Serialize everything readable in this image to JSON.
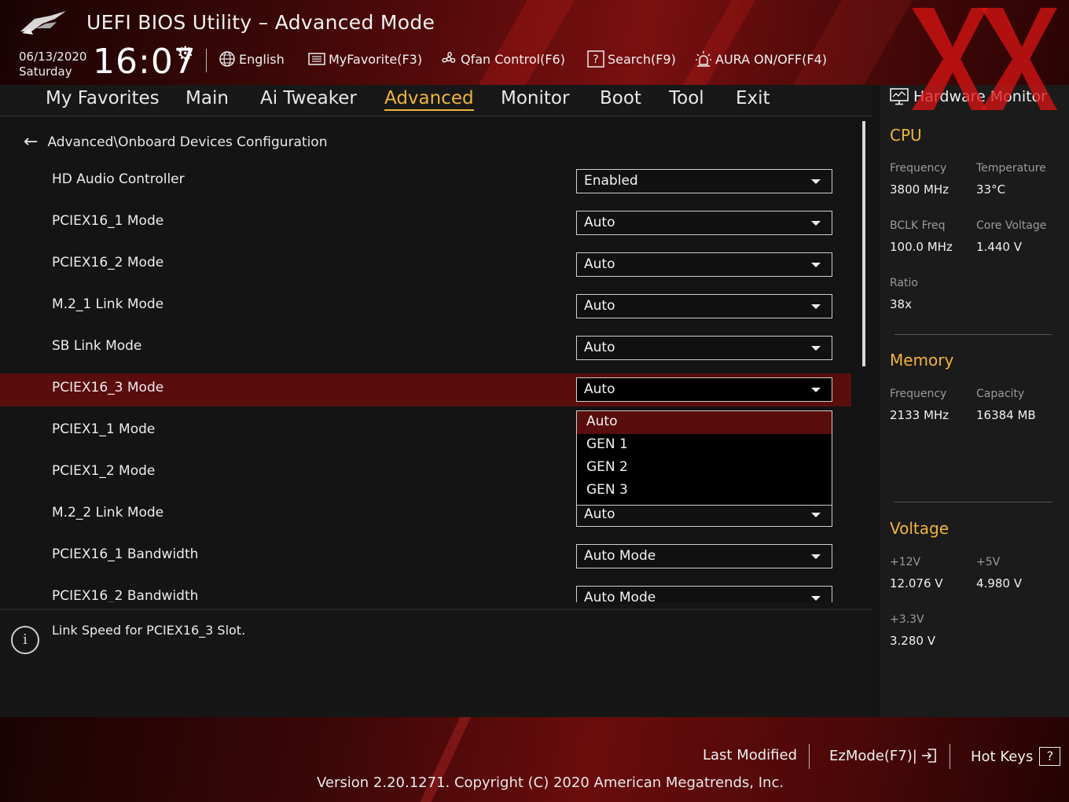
{
  "header": {
    "title": "UEFI BIOS Utility – Advanced Mode",
    "date": "06/13/2020",
    "day": "Saturday",
    "time": "16:07",
    "language": "English",
    "favorite": "MyFavorite(F3)",
    "qfan": "Qfan Control(F6)",
    "search": "Search(F9)",
    "aura": "AURA ON/OFF(F4)"
  },
  "nav": {
    "tabs": [
      "My Favorites",
      "Main",
      "Ai Tweaker",
      "Advanced",
      "Monitor",
      "Boot",
      "Tool",
      "Exit"
    ],
    "active": "Advanced"
  },
  "main": {
    "breadcrumb": "Advanced\\Onboard Devices Configuration",
    "rows": [
      {
        "label": "HD Audio Controller",
        "value": "Enabled"
      },
      {
        "label": "PCIEX16_1 Mode",
        "value": "Auto"
      },
      {
        "label": "PCIEX16_2 Mode",
        "value": "Auto"
      },
      {
        "label": "M.2_1 Link Mode",
        "value": "Auto"
      },
      {
        "label": "SB Link Mode",
        "value": "Auto"
      },
      {
        "label": "PCIEX16_3 Mode",
        "value": "Auto"
      },
      {
        "label": "PCIEX1_1 Mode",
        "value": ""
      },
      {
        "label": "PCIEX1_2 Mode",
        "value": ""
      },
      {
        "label": "M.2_2 Link Mode",
        "value": "Auto"
      },
      {
        "label": "PCIEX16_1 Bandwidth",
        "value": "Auto Mode"
      },
      {
        "label": "PCIEX16_2 Bandwidth",
        "value": "Auto Mode"
      }
    ],
    "dropdown_options": [
      "Auto",
      "GEN 1",
      "GEN 2",
      "GEN 3"
    ]
  },
  "help": {
    "text": "Link Speed for PCIEX16_3 Slot."
  },
  "hwmon": {
    "title": "Hardware Monitor",
    "cpu": {
      "heading": "CPU",
      "freq_label": "Frequency",
      "freq": "3800 MHz",
      "temp_label": "Temperature",
      "temp": "33°C",
      "bclk_label": "BCLK Freq",
      "bclk": "100.0 MHz",
      "vcore_label": "Core Voltage",
      "vcore": "1.440 V",
      "ratio_label": "Ratio",
      "ratio": "38x"
    },
    "memory": {
      "heading": "Memory",
      "freq_label": "Frequency",
      "freq": "2133 MHz",
      "cap_label": "Capacity",
      "cap": "16384 MB"
    },
    "voltage": {
      "heading": "Voltage",
      "v12_label": "+12V",
      "v12": "12.076 V",
      "v5_label": "+5V",
      "v5": "4.980 V",
      "v33_label": "+3.3V",
      "v33": "3.280 V"
    }
  },
  "footer": {
    "last_modified": "Last Modified",
    "ezmode": "EzMode(F7)|",
    "hotkeys": "Hot Keys",
    "hotkeys_icon": "?",
    "version": "Version 2.20.1271. Copyright (C) 2020 American Megatrends, Inc."
  },
  "colors": {
    "accent": "#f0b43c",
    "selected_row": "#5a0d0d"
  }
}
